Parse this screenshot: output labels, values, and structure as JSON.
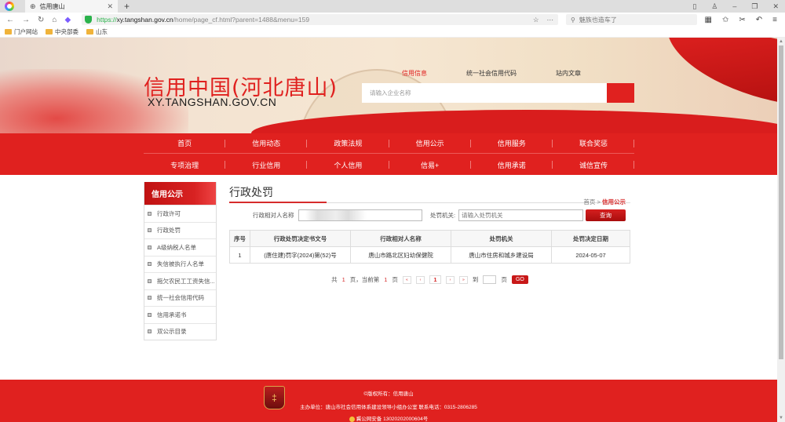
{
  "browser": {
    "tab_title": "信用唐山",
    "url_scheme": "https://",
    "url_host": "xy.tangshan.gov.cn",
    "url_path": "/home/page_cf.html?parent=1488&menu=159",
    "search_placeholder": "魅族也造车了",
    "bookmarks": [
      "门户网站",
      "中央部委",
      "山东"
    ]
  },
  "header": {
    "site_title": "信用中国(河北唐山)",
    "site_domain": "XY.TANGSHAN.GOV.CN",
    "search_tabs": [
      "信用信息",
      "统一社会信用代码",
      "站内文章"
    ],
    "search_placeholder": "请输入企业名称"
  },
  "nav": {
    "row1": [
      "首页",
      "信用动态",
      "政策法规",
      "信用公示",
      "信用服务",
      "联合奖惩"
    ],
    "row2": [
      "专项治理",
      "行业信用",
      "个人信用",
      "信易+",
      "信用承诺",
      "诚信宣传"
    ]
  },
  "sidebar": {
    "title": "信用公示",
    "items": [
      "行政许可",
      "行政处罚",
      "A级纳税人名单",
      "失信被执行人名单",
      "拖欠农民工工资失信...",
      "统一社会信用代码",
      "信用承诺书",
      "双公示目录"
    ]
  },
  "main": {
    "title": "行政处罚",
    "breadcrumb_home": "首页",
    "breadcrumb_sep": ">",
    "breadcrumb_current": "信用公示",
    "filter_name_label": "行政相对人名称",
    "filter_name_value": "",
    "filter_org_label": "处罚机关:",
    "filter_org_placeholder": "请输入处罚机关",
    "query_button": "查询",
    "table": {
      "headers": [
        "序号",
        "行政处罚决定书文号",
        "行政相对人名称",
        "处罚机关",
        "处罚决定日期"
      ],
      "rows": [
        [
          "1",
          "(唐住建)罚字(2024)第(52)号",
          "唐山市路北区妇幼保健院",
          "唐山市住房和城乡建设局",
          "2024-05-07"
        ]
      ]
    },
    "pager": {
      "total_prefix": "共",
      "total_pages": "1",
      "total_suffix": "页，当前第",
      "current_page": "1",
      "current_suffix": "页",
      "first": "«",
      "prev": "‹",
      "page_button": "1",
      "next": "›",
      "last": "»",
      "goto_label": "到",
      "goto_suffix": "页",
      "go_button": "GO"
    }
  },
  "footer": {
    "copyright": "©版权所有：信用唐山",
    "sponsor": "主办单位：唐山市社会信用体系建设领导小组办公室 联系电话：0315-2806285",
    "police_record": "冀公网安备 13020202000604号"
  }
}
